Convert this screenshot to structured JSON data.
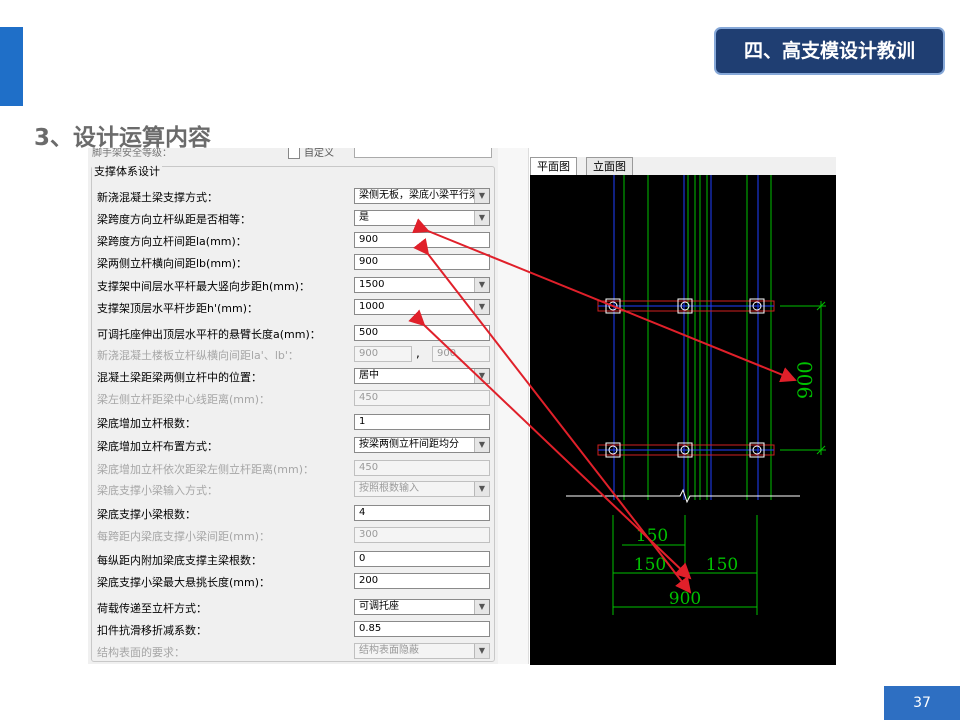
{
  "header": {
    "badge": "四、高支模设计教训",
    "section_title": "3、设计运算内容",
    "page_number": "37"
  },
  "dialog": {
    "cut_top": {
      "label": "脚手架安全等级：",
      "checkbox_label": "自定义",
      "value": ""
    },
    "group_title": "支撑体系设计",
    "rows": [
      {
        "label": "新浇混凝土梁支撑方式：",
        "value": "梁侧无板，梁底小梁平行梁跨方向",
        "type": "select",
        "disabled": false
      },
      {
        "label": "梁跨度方向立杆纵距是否相等：",
        "value": "是",
        "type": "select",
        "disabled": false
      },
      {
        "label": "梁跨度方向立杆间距la(mm)：",
        "value": "900",
        "type": "input",
        "disabled": false
      },
      {
        "label": "梁两侧立杆横向间距lb(mm)：",
        "value": "900",
        "type": "input",
        "disabled": false
      },
      {
        "label": "支撑架中间层水平杆最大竖向步距h(mm)：",
        "value": "1500",
        "type": "select",
        "disabled": false
      },
      {
        "label": "支撑架顶层水平杆步距h'(mm)：",
        "value": "1000",
        "type": "select",
        "disabled": false
      },
      {
        "label": "可调托座伸出顶层水平杆的悬臂长度a(mm)：",
        "value": "500",
        "type": "input",
        "disabled": false
      },
      {
        "label": "新浇混凝土楼板立杆纵横向间距la'、lb'：",
        "value": "900",
        "value2": "900",
        "type": "pair",
        "disabled": true
      },
      {
        "label": "混凝土梁距梁两侧立杆中的位置：",
        "value": "居中",
        "type": "select",
        "disabled": false
      },
      {
        "label": "梁左侧立杆距梁中心线距离(mm)：",
        "value": "450",
        "type": "input",
        "disabled": true
      },
      {
        "label": "梁底增加立杆根数：",
        "value": "1",
        "type": "input",
        "disabled": false
      },
      {
        "label": "梁底增加立杆布置方式：",
        "value": "按梁两侧立杆间距均分",
        "type": "select",
        "disabled": false
      },
      {
        "label": "梁底增加立杆依次距梁左侧立杆距离(mm)：",
        "value": "450",
        "type": "input",
        "disabled": true
      },
      {
        "label": "梁底支撑小梁输入方式：",
        "value": "按照根数输入",
        "type": "select",
        "disabled": true
      },
      {
        "label": "梁底支撑小梁根数：",
        "value": "4",
        "type": "input",
        "disabled": false
      },
      {
        "label": "每跨距内梁底支撑小梁间距(mm)：",
        "value": "300",
        "type": "input",
        "disabled": true
      },
      {
        "label": "每纵距内附加梁底支撑主梁根数：",
        "value": "0",
        "type": "input",
        "disabled": false
      },
      {
        "label": "梁底支撑小梁最大悬挑长度(mm)：",
        "value": "200",
        "type": "input",
        "disabled": false
      },
      {
        "label": "荷载传递至立杆方式：",
        "value": "可调托座",
        "type": "select",
        "disabled": false
      },
      {
        "label": "扣件抗滑移折减系数：",
        "value": "0.85",
        "type": "input",
        "disabled": false
      },
      {
        "label": "结构表面的要求：",
        "value": "结构表面隐蔽",
        "type": "select",
        "disabled": true
      }
    ]
  },
  "cad": {
    "tabs": [
      {
        "label": "平面图",
        "active": true
      },
      {
        "label": "立面图",
        "active": false
      }
    ],
    "dimensions": {
      "vertical": "900",
      "top_left": "150",
      "mid_left": "150",
      "mid_right": "150",
      "bottom": "900"
    }
  },
  "colors": {
    "accent": "#1f6fc8",
    "badge_bg": "#1f3e72",
    "arrow": "#e0202a",
    "cad_green": "#00c000",
    "cad_blue": "#2040ff"
  }
}
